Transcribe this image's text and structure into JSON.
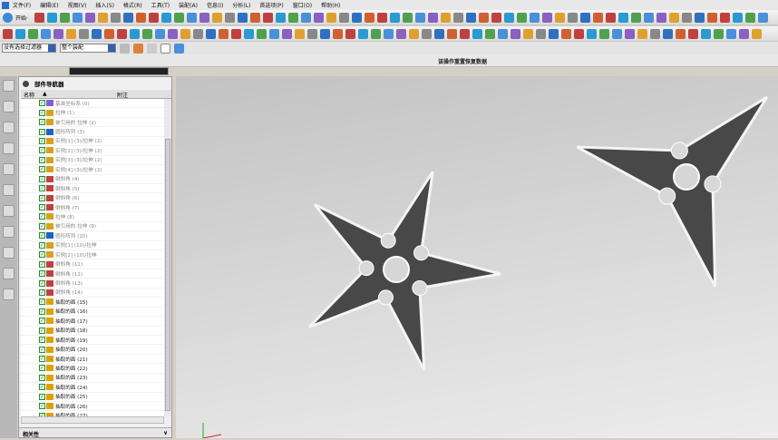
{
  "menu": [
    "文件(F)",
    "编辑(E)",
    "视图(V)",
    "插入(S)",
    "格式(R)",
    "工具(T)",
    "装配(A)",
    "信息(I)",
    "分析(L)",
    "首选项(P)",
    "窗口(O)",
    "帮助(H)"
  ],
  "toolbar": {
    "start_label": "开始·"
  },
  "filters": {
    "type_filter": "没有选择过滤器",
    "scope": "整个装配"
  },
  "status": {
    "message": "该操作重置恢复数据"
  },
  "navigator": {
    "title": "部件导航器",
    "col_name": "名称",
    "col_note": "附注",
    "items": [
      {
        "label": "基准坐标系 (0)",
        "icon": "csys",
        "dim": true
      },
      {
        "label": "拉伸 (1)",
        "icon": "extrude",
        "dim": true
      },
      {
        "label": "被引用的 拉伸 (2)",
        "icon": "extrude",
        "dim": true
      },
      {
        "label": "圆形阵列 (3)",
        "icon": "pattern",
        "dim": true
      },
      {
        "label": "实例[1] (3)/拉伸 (2)",
        "icon": "extrude",
        "dim": true
      },
      {
        "label": "实例[2] (3)/拉伸 (2)",
        "icon": "extrude",
        "dim": true
      },
      {
        "label": "实例[3] (3)/拉伸 (2)",
        "icon": "extrude",
        "dim": true
      },
      {
        "label": "实例[4] (3)/拉伸 (2)",
        "icon": "extrude",
        "dim": true
      },
      {
        "label": "倒斜角 (4)",
        "icon": "chamfer",
        "dim": true
      },
      {
        "label": "倒斜角 (5)",
        "icon": "chamfer",
        "dim": true
      },
      {
        "label": "倒斜角 (6)",
        "icon": "chamfer",
        "dim": true
      },
      {
        "label": "倒斜角 (7)",
        "icon": "chamfer",
        "dim": true
      },
      {
        "label": "拉伸 (8)",
        "icon": "extrude",
        "dim": true
      },
      {
        "label": "被引用的 拉伸 (9)",
        "icon": "extrude",
        "dim": true
      },
      {
        "label": "圆形阵列 (10)",
        "icon": "pattern",
        "dim": true
      },
      {
        "label": "实例[1] (10)/拉伸",
        "icon": "extrude",
        "dim": true
      },
      {
        "label": "实例[2] (10)/拉伸",
        "icon": "extrude",
        "dim": true
      },
      {
        "label": "倒斜角 (11)",
        "icon": "chamfer",
        "dim": true
      },
      {
        "label": "倒斜角 (12)",
        "icon": "chamfer",
        "dim": true
      },
      {
        "label": "倒斜角 (13)",
        "icon": "chamfer",
        "dim": true
      },
      {
        "label": "倒斜角 (14)",
        "icon": "chamfer",
        "dim": true
      },
      {
        "label": "抽取的面 (15)",
        "icon": "extract",
        "dim": false
      },
      {
        "label": "抽取的面 (16)",
        "icon": "extract",
        "dim": false
      },
      {
        "label": "抽取的面 (17)",
        "icon": "extract",
        "dim": false
      },
      {
        "label": "抽取的面 (18)",
        "icon": "extract",
        "dim": false
      },
      {
        "label": "抽取的面 (19)",
        "icon": "extract",
        "dim": false
      },
      {
        "label": "抽取的面 (20)",
        "icon": "extract",
        "dim": false
      },
      {
        "label": "抽取的面 (21)",
        "icon": "extract",
        "dim": false
      },
      {
        "label": "抽取的面 (22)",
        "icon": "extract",
        "dim": false
      },
      {
        "label": "抽取的面 (23)",
        "icon": "extract",
        "dim": false
      },
      {
        "label": "抽取的面 (24)",
        "icon": "extract",
        "dim": false
      },
      {
        "label": "抽取的面 (25)",
        "icon": "extract",
        "dim": false
      },
      {
        "label": "抽取的面 (26)",
        "icon": "extract",
        "dim": false
      },
      {
        "label": "抽取的面 (27)",
        "icon": "extract",
        "dim": false
      }
    ],
    "dependents_label": "相关性"
  },
  "colors": {
    "csys": "#8060d0",
    "extrude": "#d8a020",
    "pattern": "#2060c0",
    "chamfer": "#c04040",
    "extract": "#e0a000",
    "model": "#484848"
  }
}
